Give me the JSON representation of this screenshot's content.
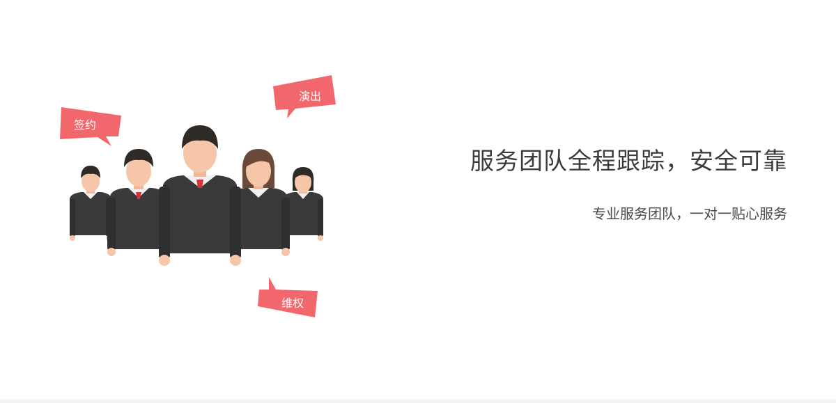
{
  "banner": {
    "headline": "服务团队全程跟踪，安全可靠",
    "subline": "专业服务团队，一对一贴心服务",
    "bubbles": {
      "sign": "签约",
      "perform": "演出",
      "protect": "维权"
    },
    "colors": {
      "bubble": "#f2676b",
      "suit": "#3a3a3a",
      "skin": "#f6c6a9",
      "hair": "#2e2a28",
      "tie": "#d6303b",
      "text_main": "#3c3c3c"
    }
  }
}
